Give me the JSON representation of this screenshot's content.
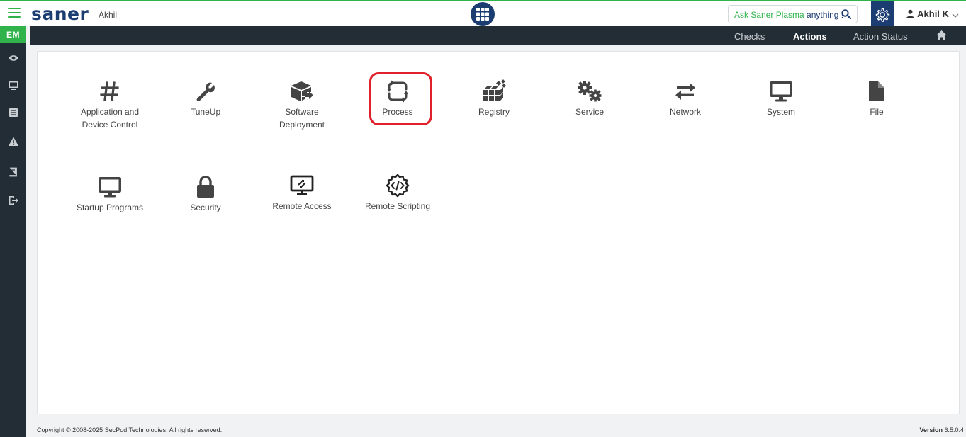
{
  "header": {
    "logo": "saner",
    "tenant": "Akhil",
    "ask_prefix": "Ask Saner Plasma ",
    "ask_suffix": "anything !",
    "user_name": "Akhil K"
  },
  "sidebar": {
    "badge": "EM"
  },
  "subnav": {
    "items": [
      "Checks",
      "Actions",
      "Action Status"
    ],
    "active": "Actions"
  },
  "tiles": [
    {
      "label_line1": "Application and",
      "label_line2": "Device Control",
      "icon": "hash-icon"
    },
    {
      "label_line1": "TuneUp",
      "label_line2": "",
      "icon": "wrench-icon"
    },
    {
      "label_line1": "Software",
      "label_line2": "Deployment",
      "icon": "software-box-icon"
    },
    {
      "label_line1": "Process",
      "label_line2": "",
      "icon": "sync-arrows-icon"
    },
    {
      "label_line1": "Registry",
      "label_line2": "",
      "icon": "registry-cubes-icon"
    },
    {
      "label_line1": "Service",
      "label_line2": "",
      "icon": "gears-icon"
    },
    {
      "label_line1": "Network",
      "label_line2": "",
      "icon": "exchange-arrows-icon"
    },
    {
      "label_line1": "System",
      "label_line2": "",
      "icon": "desktop-icon"
    },
    {
      "label_line1": "File",
      "label_line2": "",
      "icon": "file-icon"
    },
    {
      "label_line1": "Startup Programs",
      "label_line2": "",
      "icon": "desktop-icon"
    },
    {
      "label_line1": "Security",
      "label_line2": "",
      "icon": "lock-icon"
    },
    {
      "label_line1": "Remote Access",
      "label_line2": "",
      "icon": "remote-screen-icon"
    },
    {
      "label_line1": "Remote Scripting",
      "label_line2": "",
      "icon": "code-gear-icon"
    }
  ],
  "footer": {
    "copyright": "Copyright © 2008-2025 SecPod Technologies. All rights reserved.",
    "version_label": "Version",
    "version": "6.5.0.4"
  },
  "colors": {
    "brand_green": "#2fb34a",
    "brand_navy": "#1c3d72",
    "sidebar_bg": "#232d35",
    "highlight_red": "#e0212b"
  }
}
